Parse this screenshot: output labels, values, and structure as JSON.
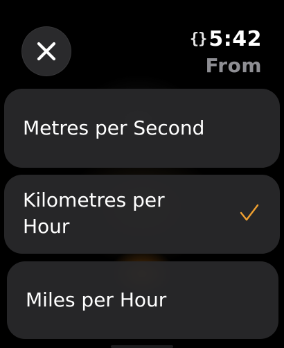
{
  "status_bar": {
    "indicator_glyph": "{}",
    "time": "5:42"
  },
  "header": {
    "title": "From"
  },
  "options": [
    {
      "label": "Metres per Second",
      "selected": false
    },
    {
      "label": "Kilometres per Hour",
      "selected": true
    },
    {
      "label": "Miles per Hour",
      "selected": false
    }
  ],
  "colors": {
    "accent": "#F0A030",
    "title_gray": "#8E8E93",
    "cell_background": "#28282A"
  },
  "icons": {
    "close": "close-icon",
    "checkmark": "checkmark-icon"
  }
}
